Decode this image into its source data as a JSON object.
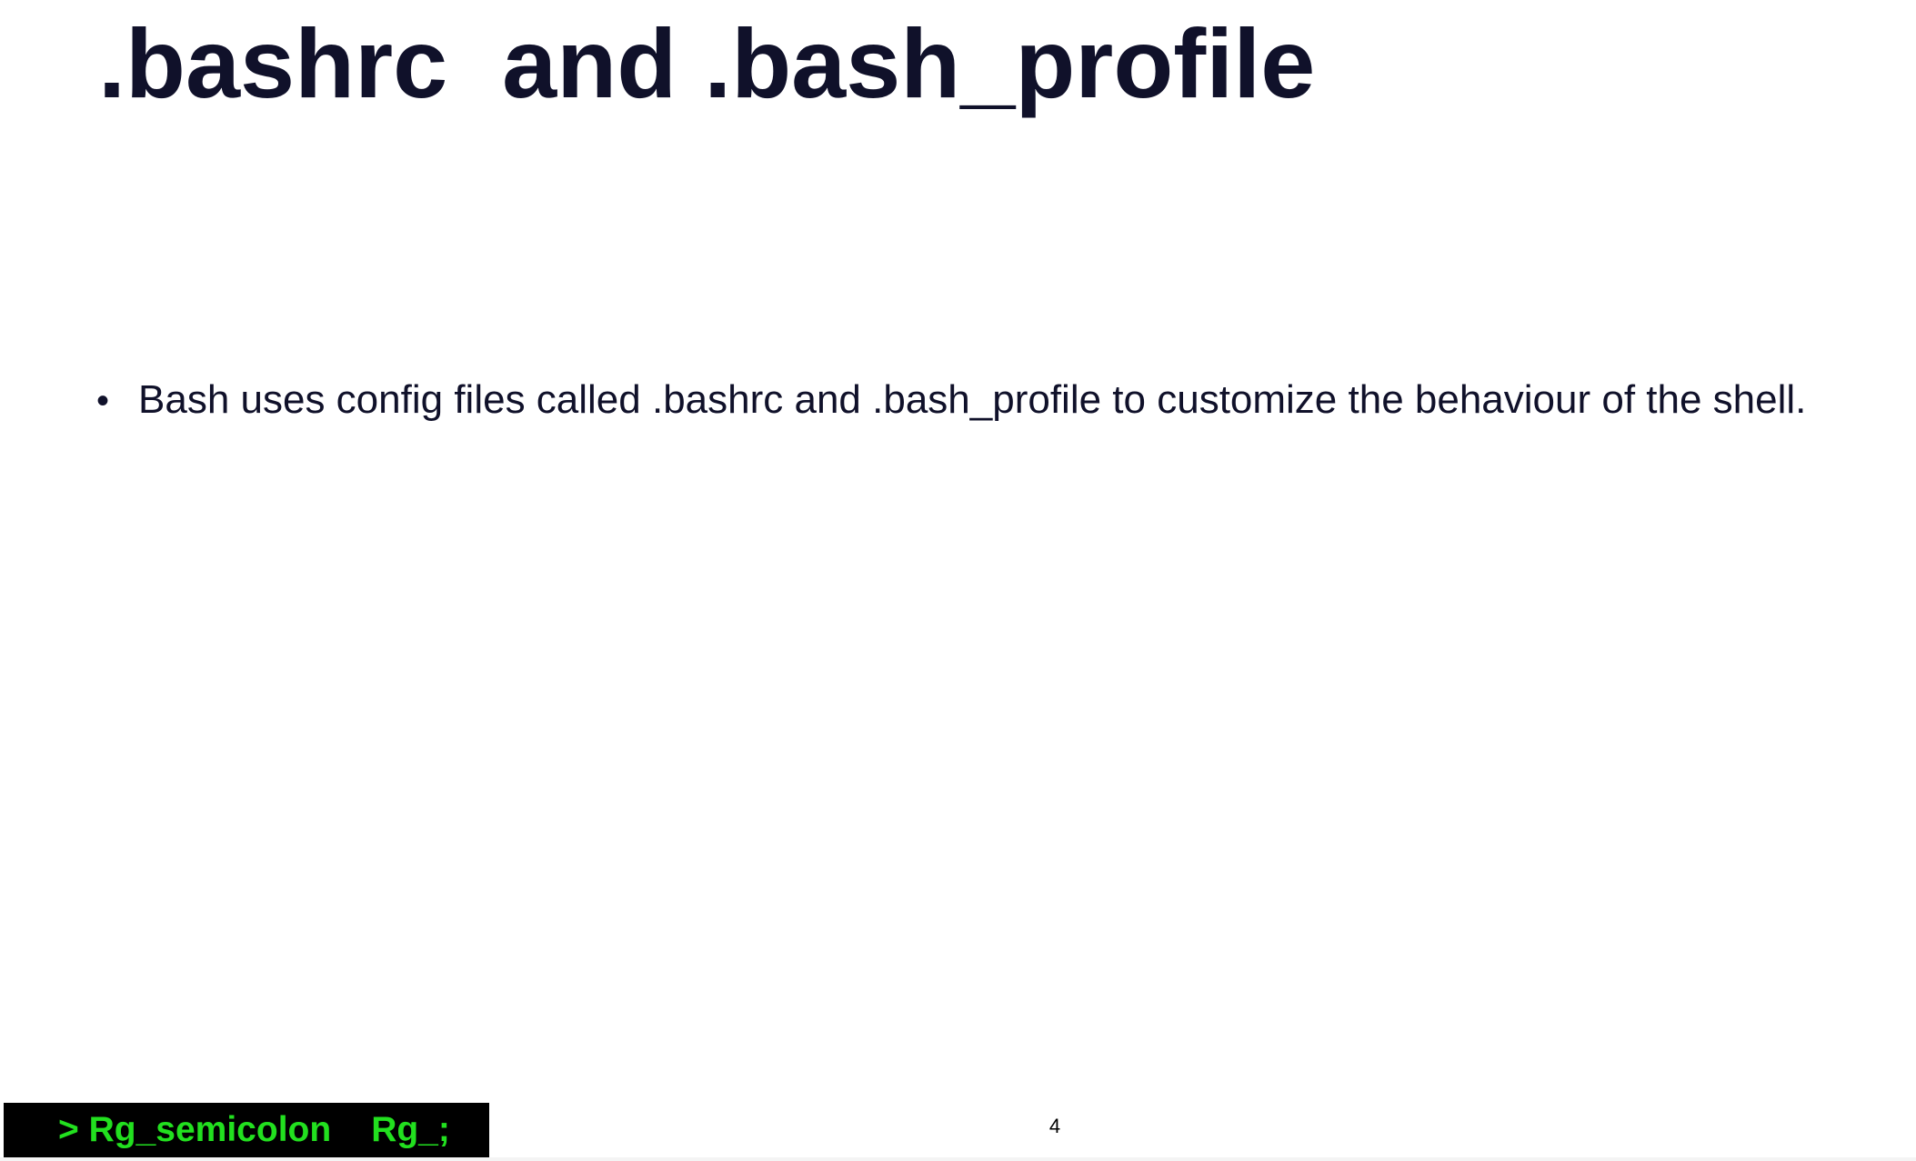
{
  "slide": {
    "title": ".bashrc  and .bash_profile",
    "bullets": [
      "Bash uses config files called .bashrc and .bash_profile to customize the behaviour of the shell."
    ],
    "footer": {
      "left_text": "> Rg_semicolon",
      "right_text": "Rg_;"
    },
    "page_number": "4"
  },
  "colors": {
    "title_text": "#10112a",
    "body_text": "#10112a",
    "banner_bg": "#000000",
    "banner_text": "#22e01f"
  }
}
